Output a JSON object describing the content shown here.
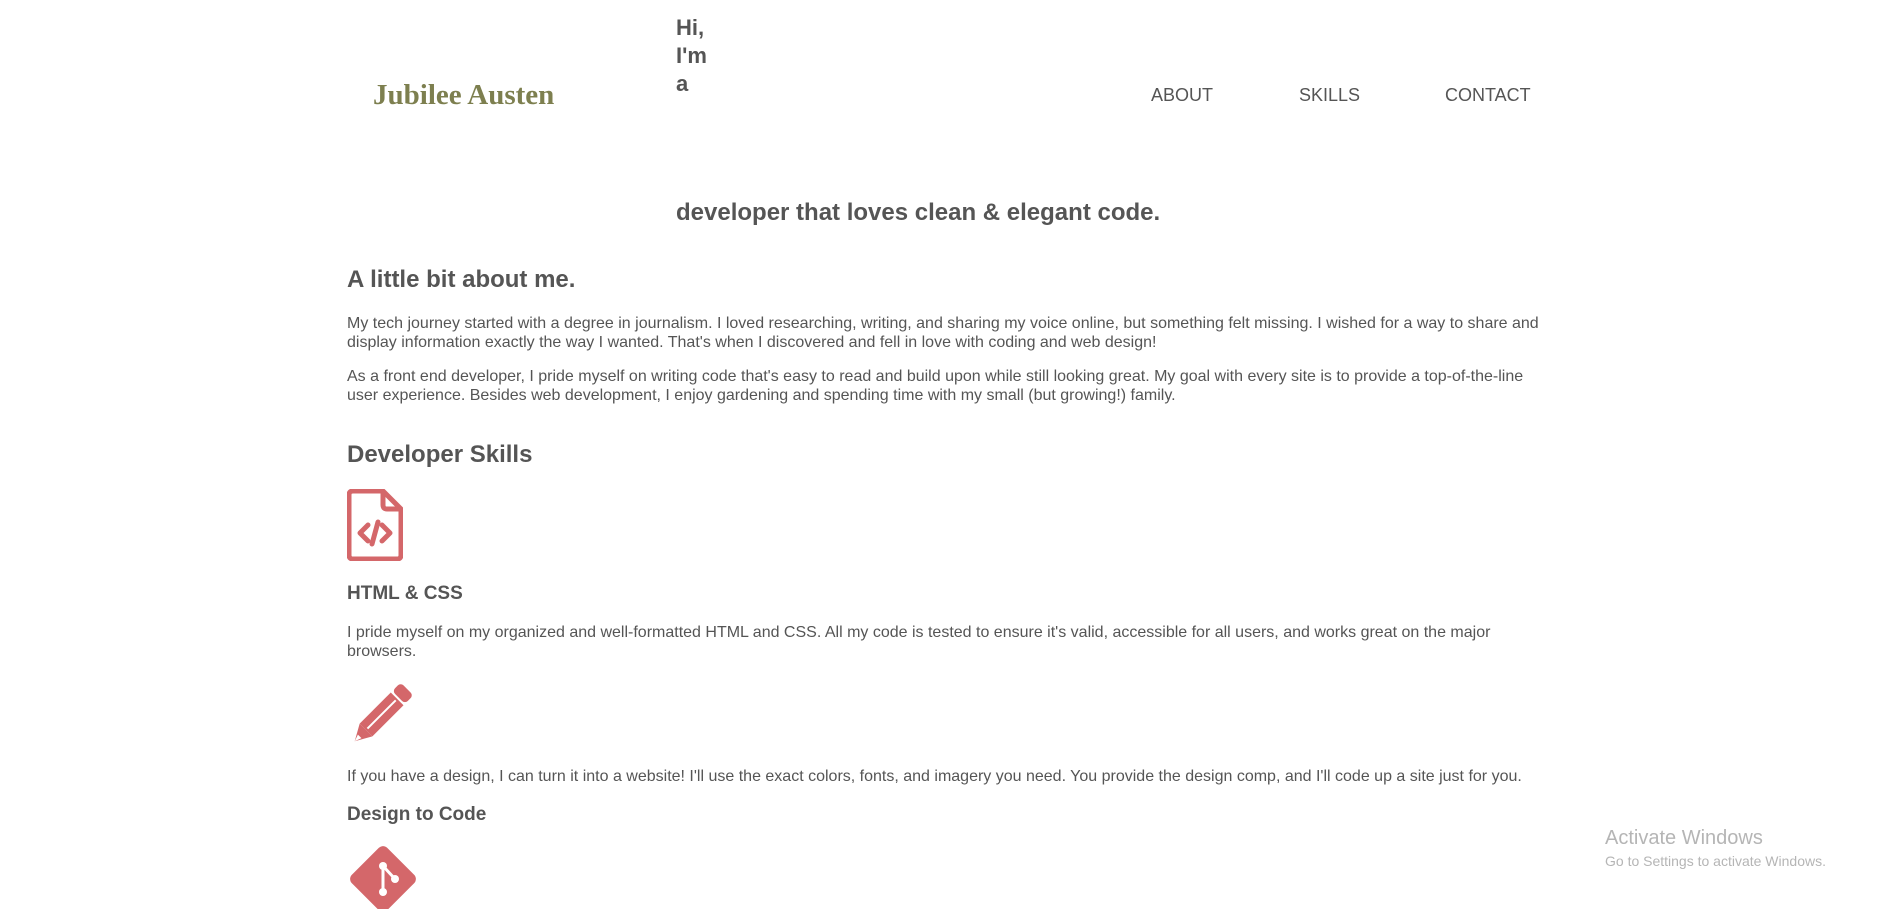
{
  "header": {
    "logo": "Jubilee Austen",
    "intro": "Hi, I'm a",
    "nav": {
      "about": "ABOUT",
      "skills": "SKILLS",
      "contact": "CONTACT"
    }
  },
  "hero": {
    "tagline": "developer that loves clean & elegant code."
  },
  "about": {
    "heading": "A little bit about me.",
    "paragraphs": [
      "My tech journey started with a degree in journalism. I loved researching, writing, and sharing my voice online, but something felt missing. I wished for a way to share and display information exactly the way I wanted. That's when I discovered and fell in love with coding and web design!",
      "As a front end developer, I pride myself on writing code that's easy to read and build upon while still looking great. My goal with every site is to provide a top-of-the-line user experience. Besides web development, I enjoy gardening and spending time with my small (but growing!) family."
    ]
  },
  "skills": {
    "heading": "Developer Skills",
    "items": [
      {
        "icon": "file-code-icon",
        "title": "HTML & CSS",
        "description": "I pride myself on my organized and well-formatted HTML and CSS. All my code is tested to ensure it's valid, accessible for all users, and works great on the major browsers."
      },
      {
        "icon": "pencil-icon",
        "title": "Design to Code",
        "description": "If you have a design, I can turn it into a website! I'll use the exact colors, fonts, and imagery you need. You provide the design comp, and I'll code up a site just for you."
      },
      {
        "icon": "git-icon"
      }
    ]
  },
  "os_watermark": {
    "title": "Activate Windows",
    "subtitle": "Go to Settings to activate Windows."
  },
  "colors": {
    "logo": "#7d7f4f",
    "text": "#555555",
    "icon": "#d4676a",
    "watermark": "#b5b5b5"
  }
}
